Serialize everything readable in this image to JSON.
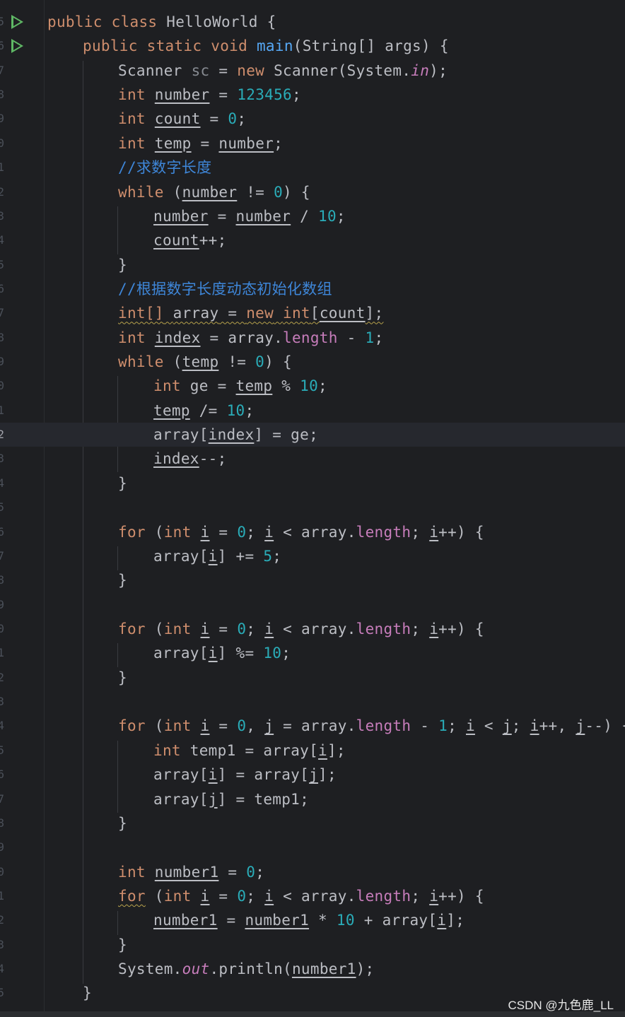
{
  "editor": {
    "line_numbers": [
      "5",
      "6",
      "7",
      "8",
      "9",
      "0",
      "1",
      "2",
      "3",
      "4",
      "5",
      "6",
      "7",
      "8",
      "9",
      "0",
      "1",
      "2",
      "3",
      "4",
      "5",
      "6",
      "7",
      "8",
      "9",
      "0",
      "1",
      "2",
      "3",
      "4",
      "5",
      "6",
      "7",
      "8",
      "9",
      "0",
      "1",
      "2",
      "3",
      "4",
      "5"
    ],
    "current_line_index": 17,
    "colors": {
      "background": "#1e1f22",
      "keyword": "#cf8e6d",
      "method": "#56a8f5",
      "number": "#2aacb8",
      "field": "#c77dbb",
      "comment": "#3e86d8",
      "run_icon": "#5fb865"
    },
    "gutter_icons": [
      "run-main-icon",
      "run-main-icon"
    ],
    "code": {
      "kw_public": "public",
      "kw_class": "class",
      "class_name": "HelloWorld",
      "kw_static": "static",
      "kw_void": "void",
      "method_main": "main",
      "type_string": "String[]",
      "param_args": "args",
      "type_scanner": "Scanner",
      "var_sc": "sc",
      "kw_new": "new",
      "type_system": "System",
      "field_in": "in",
      "field_out": "out",
      "method_println": "println",
      "kw_int": "int",
      "kw_int_arr": "int[]",
      "kw_while": "while",
      "kw_for": "for",
      "var_number": "number",
      "var_count": "count",
      "var_temp": "temp",
      "var_array": "array",
      "var_index": "index",
      "var_ge": "ge",
      "var_i": "i",
      "var_j": "j",
      "var_temp1": "temp1",
      "var_number1": "number1",
      "field_length": "length",
      "num_123456": "123456",
      "num_0": "0",
      "num_1": "1",
      "num_5": "5",
      "num_10": "10",
      "comment_length": "//求数字长度",
      "comment_array": "//根据数字长度动态初始化数组"
    }
  },
  "watermark": "CSDN @九色鹿_LL"
}
